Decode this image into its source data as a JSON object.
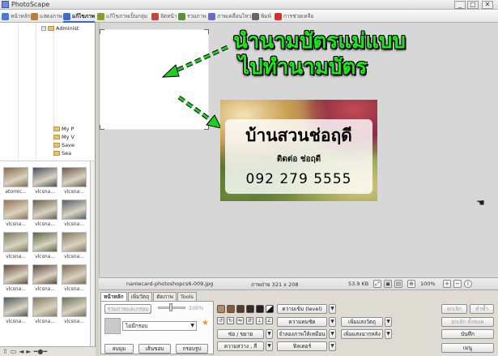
{
  "window": {
    "title": "PhotoScape",
    "minimize": "_",
    "maximize": "□",
    "close": "✕"
  },
  "tabs": [
    {
      "label": "หน้าหลัก",
      "icon": "home-icon",
      "color": "#4a7bd1"
    },
    {
      "label": "แสดงภาพ",
      "icon": "viewer-icon",
      "color": "#b5813a"
    },
    {
      "label": "แก้ไขภาพ",
      "icon": "editor-icon",
      "color": "#3d6fc2",
      "active": true
    },
    {
      "label": "แก้ไขภาพเป็นกลุ่ม",
      "icon": "batch-icon",
      "color": "#8a9a3a"
    },
    {
      "label": "จัดหน้า",
      "icon": "page-icon",
      "color": "#c2483b"
    },
    {
      "label": "รวมภาพ",
      "icon": "combine-icon",
      "color": "#5b8e3f"
    },
    {
      "label": "ภาพเคลื่อนไหว",
      "icon": "gif-icon",
      "color": "#6a6ac8"
    },
    {
      "label": "พิมพ์",
      "icon": "print-icon",
      "color": "#666666"
    },
    {
      "label": "การช่วยเหลือ",
      "icon": "help-icon",
      "color": "#d43030"
    }
  ],
  "tree": {
    "nodes": [
      {
        "label": "Administ"
      },
      {
        "label": "My P"
      },
      {
        "label": "My V"
      },
      {
        "label": "Save"
      },
      {
        "label": "Sea"
      }
    ]
  },
  "thumbnails": [
    {
      "caption": "atomic...",
      "color": "#8a6a4a"
    },
    {
      "caption": "vlcsna...",
      "color": "#4a5060"
    },
    {
      "caption": "vlcsna...",
      "color": "#6f5a48"
    },
    {
      "caption": "vlcsna...",
      "color": "#9a7350"
    },
    {
      "caption": "vlcsna...",
      "color": "#6a6050"
    },
    {
      "caption": "vlcsna...",
      "color": "#55606a"
    },
    {
      "caption": "vlcsna...",
      "color": "#7b7a58"
    },
    {
      "caption": "vlcsna...",
      "color": "#5a6640"
    },
    {
      "caption": "vlcsna...",
      "color": "#86785a"
    },
    {
      "caption": "vlcsna...",
      "color": "#6a4a3a"
    },
    {
      "caption": "vlcsna...",
      "color": "#5a4a40"
    },
    {
      "caption": "vlcsna...",
      "color": "#7d6a52"
    },
    {
      "caption": "vlcsna...",
      "color": "#4f5a60"
    },
    {
      "caption": "vlcsna...",
      "color": "#8a7a60"
    },
    {
      "caption": "vlcsna...",
      "color": "#6b7458"
    }
  ],
  "overlay": {
    "line1": "นำนามบัตรแม่แบบ",
    "line2": "ไปทำนามบัตร"
  },
  "namecard": {
    "title": "บ้านสวนช่อฤดี",
    "contact": "ติดต่อ ช่อฤดี",
    "phone": "092 279 5555"
  },
  "status": {
    "filename": "namecard-photoshopcs6-009.jpg",
    "dimensions": "ภาพถ่าย 321 x 208",
    "filesize": "53.9 KB",
    "zoom": "100%"
  },
  "tools": {
    "subtabs": [
      "หน้าหลัก",
      "เพิ่มวัตถุ",
      "ตัดภาพ",
      "Tools"
    ],
    "combine_button": "รวมภาพและกรอบ",
    "slider_value": "100%",
    "frame_select": "ไม่มีกรอบ",
    "margin_button": "ลบมุม",
    "border_button": "เส้นขอบ",
    "frame_button": "กรอบรูป",
    "rotate": "ซ่อ / ขยาย",
    "brightness": "ความสว่าง , สี",
    "level": "ความเข้ม (level)",
    "sharpen": "ความคมชัด",
    "backlight": "จำลองภาพให้เหมือน",
    "filter": "ฟิลเตอร์",
    "add_object": "เพิ่มแสงวัตถุ",
    "add_backlight": "เพิ่มแสงฉากหลัง",
    "undo": "ยกเลิก",
    "redo": "ทำซ้ำ",
    "undo_all": "ยกเลิก ทั้งหมด",
    "save": "บันทึก",
    "menu": "เมนู"
  }
}
